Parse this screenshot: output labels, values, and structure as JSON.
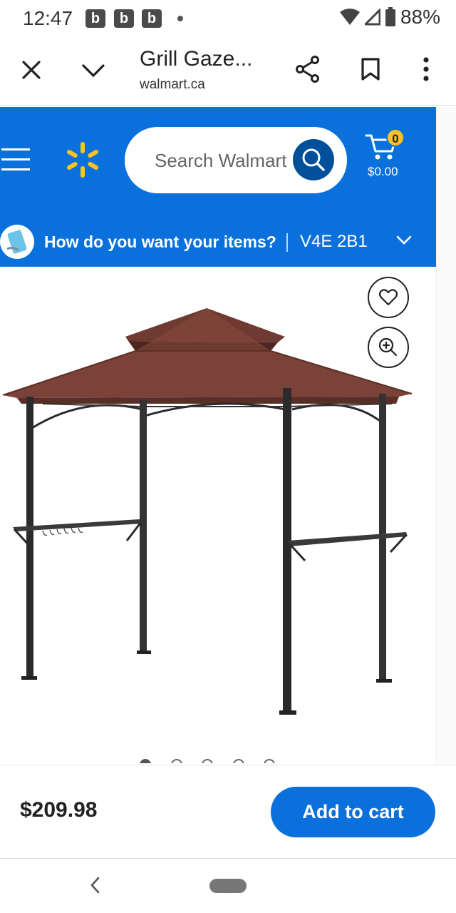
{
  "status_bar": {
    "time": "12:47",
    "notifications": [
      "b",
      "b",
      "b"
    ],
    "battery": "88%"
  },
  "browser": {
    "title": "Grill Gaze...",
    "url": "walmart.ca",
    "icons": [
      "close-icon",
      "chevron-down-icon",
      "share-icon",
      "bookmark-icon",
      "more-vert-icon"
    ]
  },
  "header": {
    "search_placeholder": "Search Walmart",
    "cart_count": "0",
    "cart_total": "$0.00",
    "fulfillment_question": "How do you want your items?",
    "postal_code": "V4E 2B1",
    "colors": {
      "brand_blue": "#0a71dc",
      "spark_yellow": "#ffc220",
      "search_button": "#004f9a"
    }
  },
  "product": {
    "image_name": "Grill gazebo",
    "carousel_count": 5,
    "carousel_active": 1
  },
  "buy_bar": {
    "price": "$209.98",
    "add_to_cart": "Add to cart"
  }
}
